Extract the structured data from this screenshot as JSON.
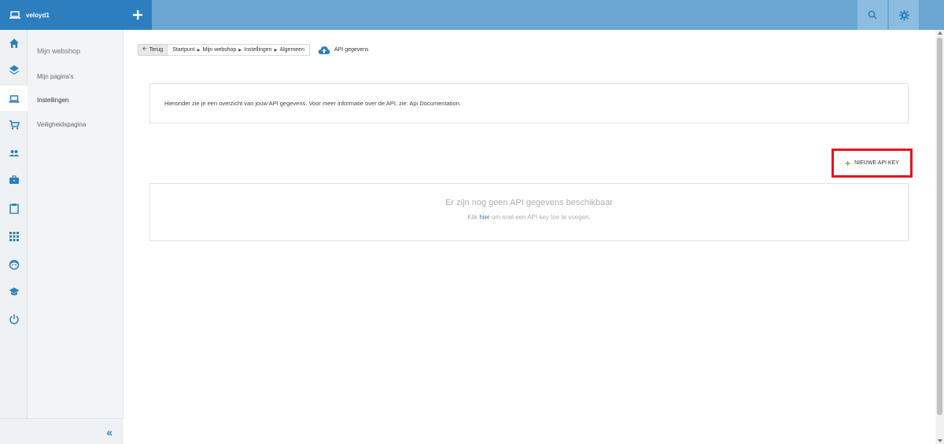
{
  "app": {
    "workspace_name": "veloyd1"
  },
  "sidebar": {
    "icons": [
      "home-icon",
      "layers-icon",
      "laptop-icon",
      "cart-icon",
      "users-icon",
      "briefcase-icon",
      "clipboard-icon",
      "apps-grid-icon",
      "smiley-icon",
      "graduation-cap-icon",
      "power-icon"
    ],
    "active_icon": "laptop-icon",
    "submenu_header": "Mijn webshop",
    "submenu_items": [
      {
        "label": "Mijn pagina's"
      },
      {
        "label": "Instellingen"
      },
      {
        "label": "Veiligheidspagina"
      }
    ],
    "collapse_label": "«"
  },
  "breadcrumb": {
    "back_label": "Terug",
    "path": [
      "Startpunt",
      "Mijn webshop",
      "Instellingen",
      "Algemeen"
    ],
    "current": "API gegevens"
  },
  "info": {
    "text": "Hieronder zie je een overzicht van jouw API gegevens. Voor meer informatie over de API, zie: Api Documentation."
  },
  "actions": {
    "new_key_label": "NIEUWE API KEY"
  },
  "empty_state": {
    "title": "Er zijn nog geen API gegevens beschikbaar",
    "sub_prefix": "Klik",
    "sub_link": "hier",
    "sub_suffix": "om snel een API key toe te voegen."
  },
  "colors": {
    "brand_blue": "#2d7ebf",
    "topbar_blue": "#6aa6d1",
    "highlight_red": "#e8121a",
    "plus_green": "#6cb33f"
  }
}
